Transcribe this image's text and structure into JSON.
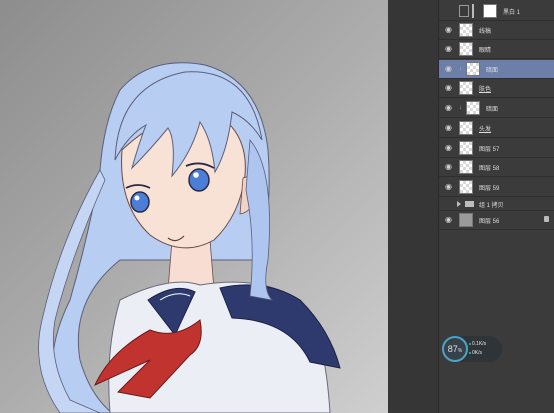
{
  "canvas": {
    "subject": "anime-girl-illustration"
  },
  "layers_panel": {
    "top_layer": {
      "name": "黑白 1"
    },
    "layers": [
      {
        "name": "线稿",
        "thumb": "checker",
        "visible": true
      },
      {
        "name": "眼睛",
        "thumb": "checker",
        "visible": true
      },
      {
        "name": "暗面",
        "thumb": "checker",
        "visible": true,
        "selected": true,
        "clipped": true
      },
      {
        "name": "肤色",
        "thumb": "checker",
        "visible": true,
        "underline": true
      },
      {
        "name": "暗面",
        "thumb": "checker",
        "visible": true,
        "clipped": true
      },
      {
        "name": "头发",
        "thumb": "checker",
        "visible": true,
        "underline": true
      },
      {
        "name": "图层 57",
        "thumb": "checker",
        "visible": true
      },
      {
        "name": "图层 58",
        "thumb": "checker",
        "visible": true
      },
      {
        "name": "图层 59",
        "thumb": "checker",
        "visible": true
      }
    ],
    "group": {
      "name": "组 1 拷贝",
      "visible": false
    },
    "base_layer": {
      "name": "图层 56",
      "locked": true
    }
  },
  "perf_widget": {
    "percent": "87",
    "percent_suffix": "%",
    "up_rate": "0.1K/s",
    "down_rate": "0K/s",
    "ring_color": "#4da3c7",
    "dot_color": "#37c49b"
  },
  "colors": {
    "hair": "#b8cdf2",
    "collar": "#2e3a6e",
    "scarf": "#c0332f",
    "uniform": "#eceef5",
    "eye": "#4a7ed8"
  }
}
